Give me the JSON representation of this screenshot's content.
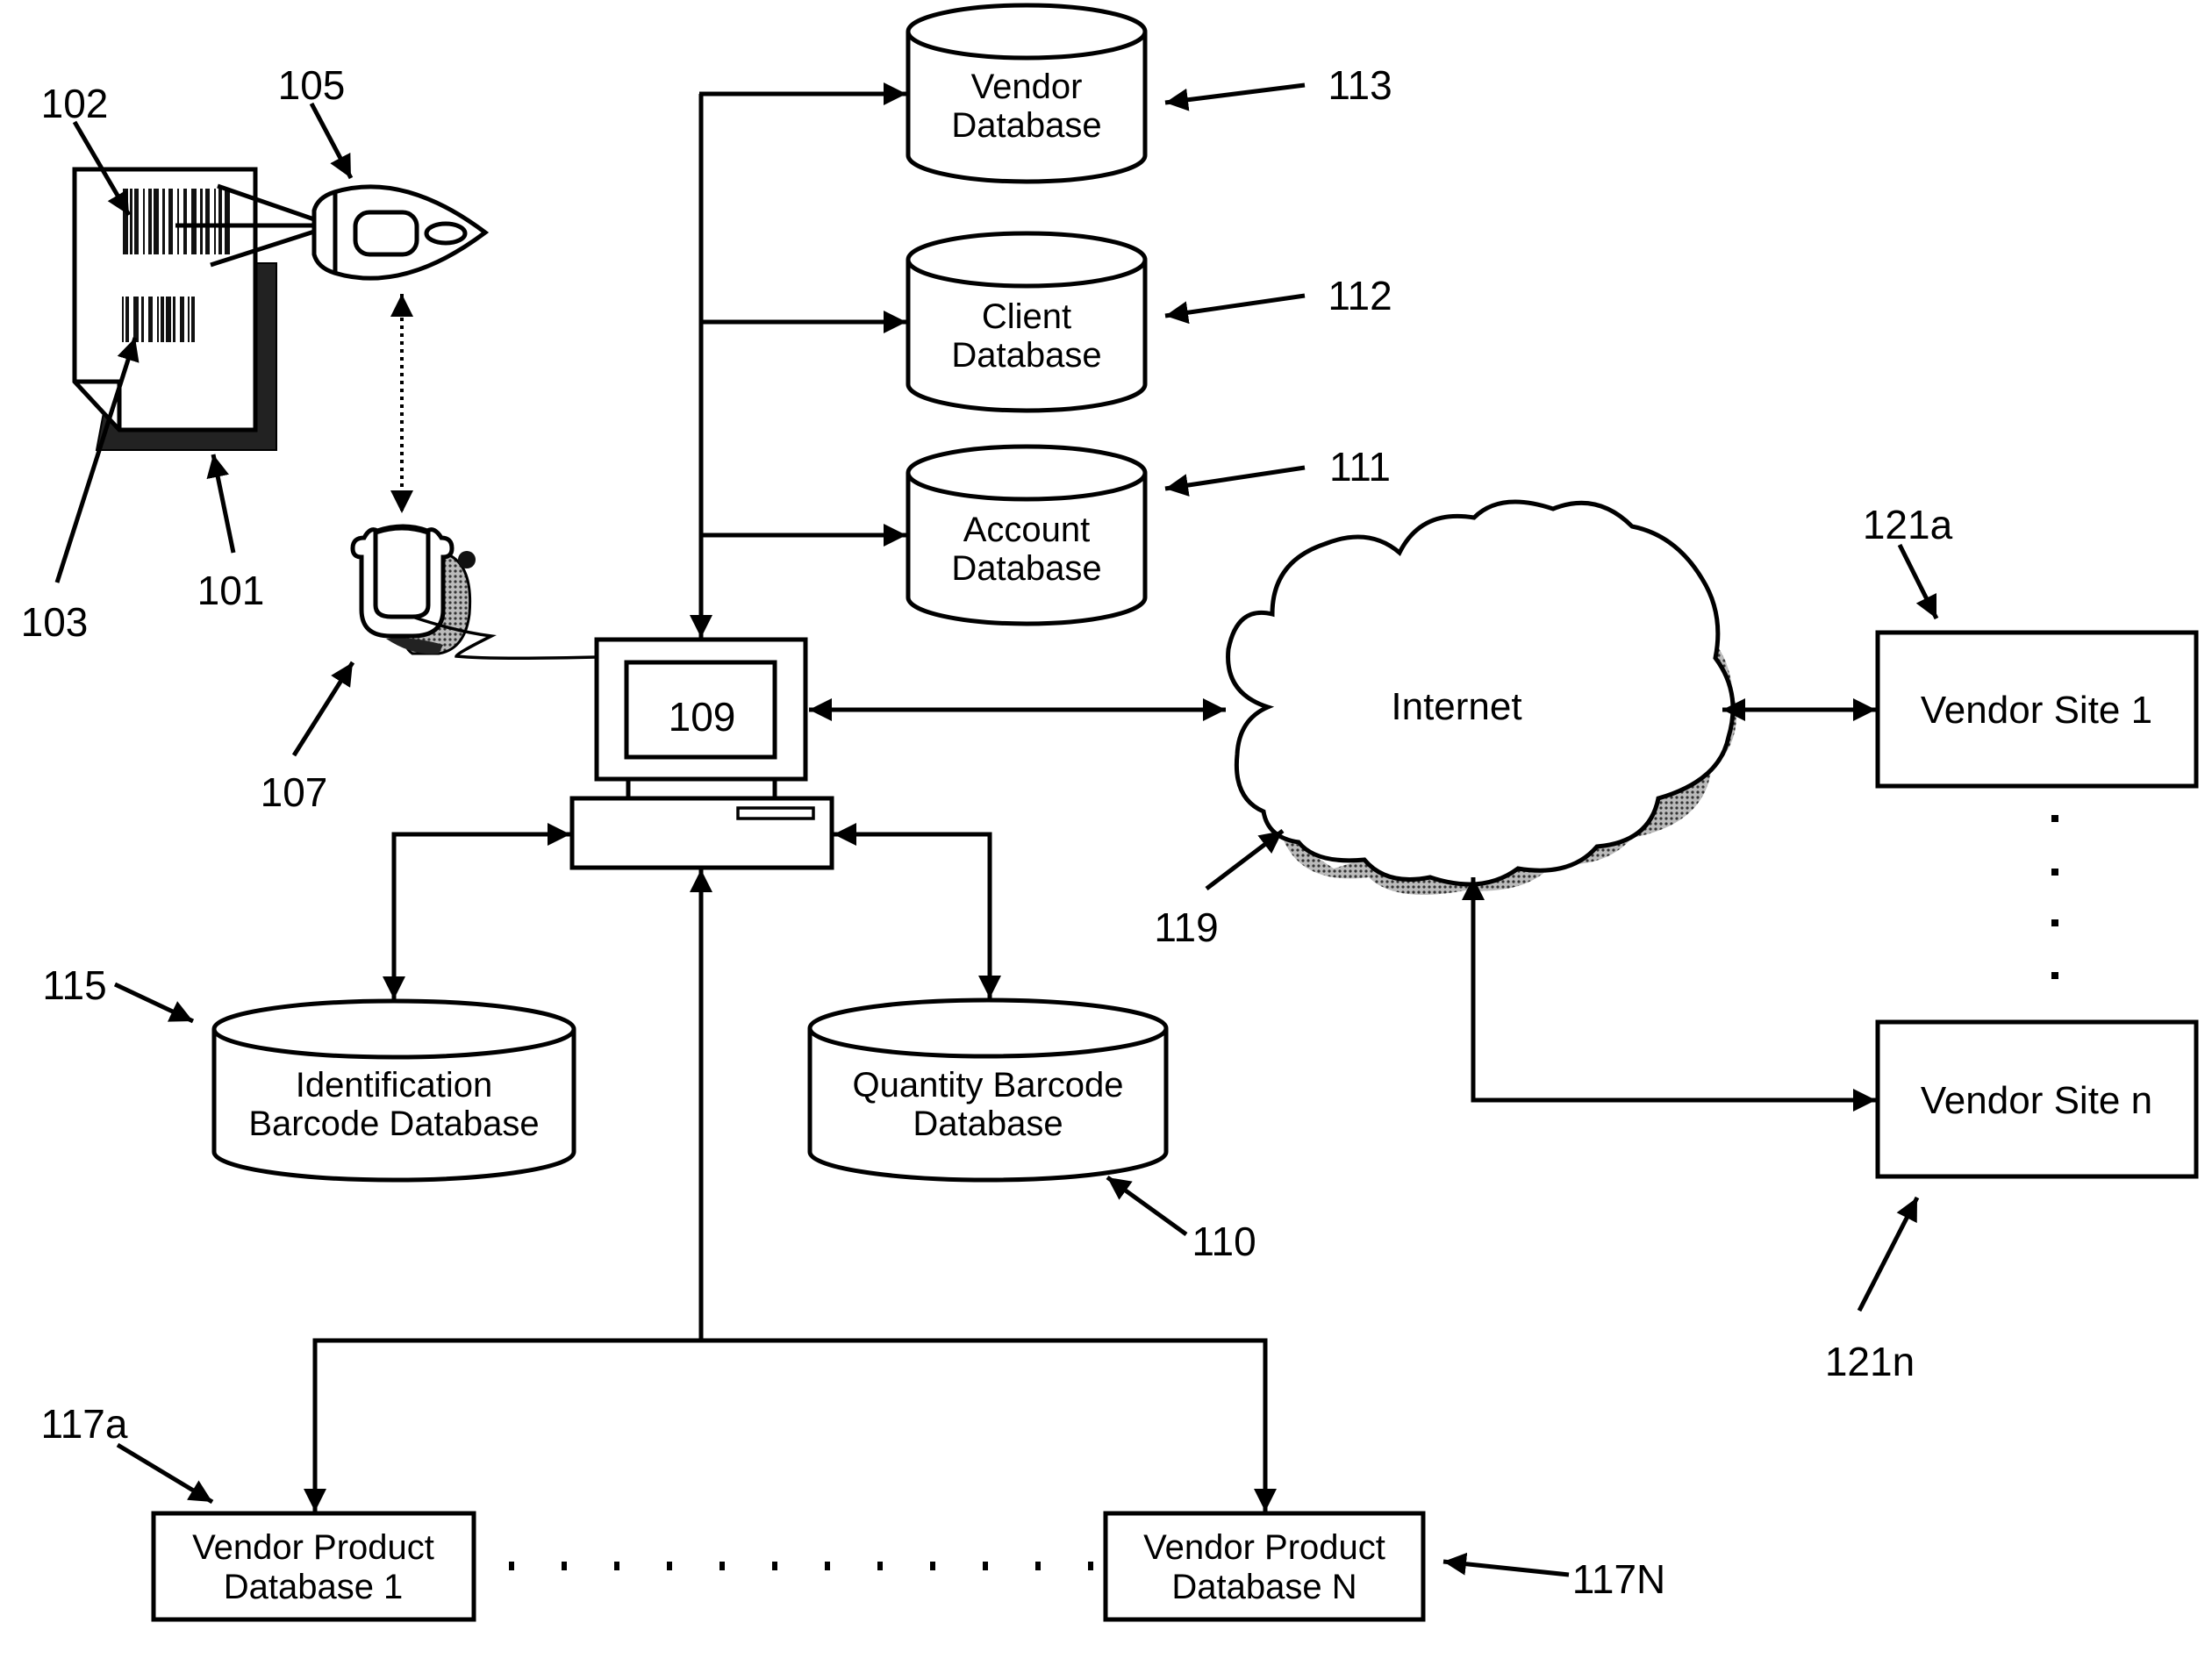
{
  "figure": {
    "components": {
      "vendor_db": {
        "line1": "Vendor",
        "line2": "Database",
        "ref": "113"
      },
      "client_db": {
        "line1": "Client",
        "line2": "Database",
        "ref": "112"
      },
      "account_db": {
        "line1": "Account",
        "line2": "Database",
        "ref": "111"
      },
      "computer": {
        "ref": "109"
      },
      "id_barcode_db": {
        "line1": "Identification",
        "line2": "Barcode Database",
        "ref": "115"
      },
      "qty_barcode_db": {
        "line1": "Quantity Barcode",
        "line2": "Database",
        "ref": "110"
      },
      "internet": {
        "label": "Internet",
        "ref": "119"
      },
      "vendor_site_1": {
        "label": "Vendor Site 1",
        "ref": "121a"
      },
      "vendor_site_n": {
        "label": "Vendor Site n",
        "ref": "121n"
      },
      "vendor_product_db_1": {
        "line1": "Vendor Product",
        "line2": "Database 1",
        "ref": "117a"
      },
      "vendor_product_db_n": {
        "line1": "Vendor Product",
        "line2": "Database N",
        "ref": "117N"
      },
      "document": {
        "ref": "101"
      },
      "identification_barcode": {
        "ref": "102"
      },
      "quantity_barcode": {
        "ref": "103"
      },
      "scanner": {
        "ref": "105"
      },
      "cradle": {
        "ref": "107"
      }
    }
  }
}
